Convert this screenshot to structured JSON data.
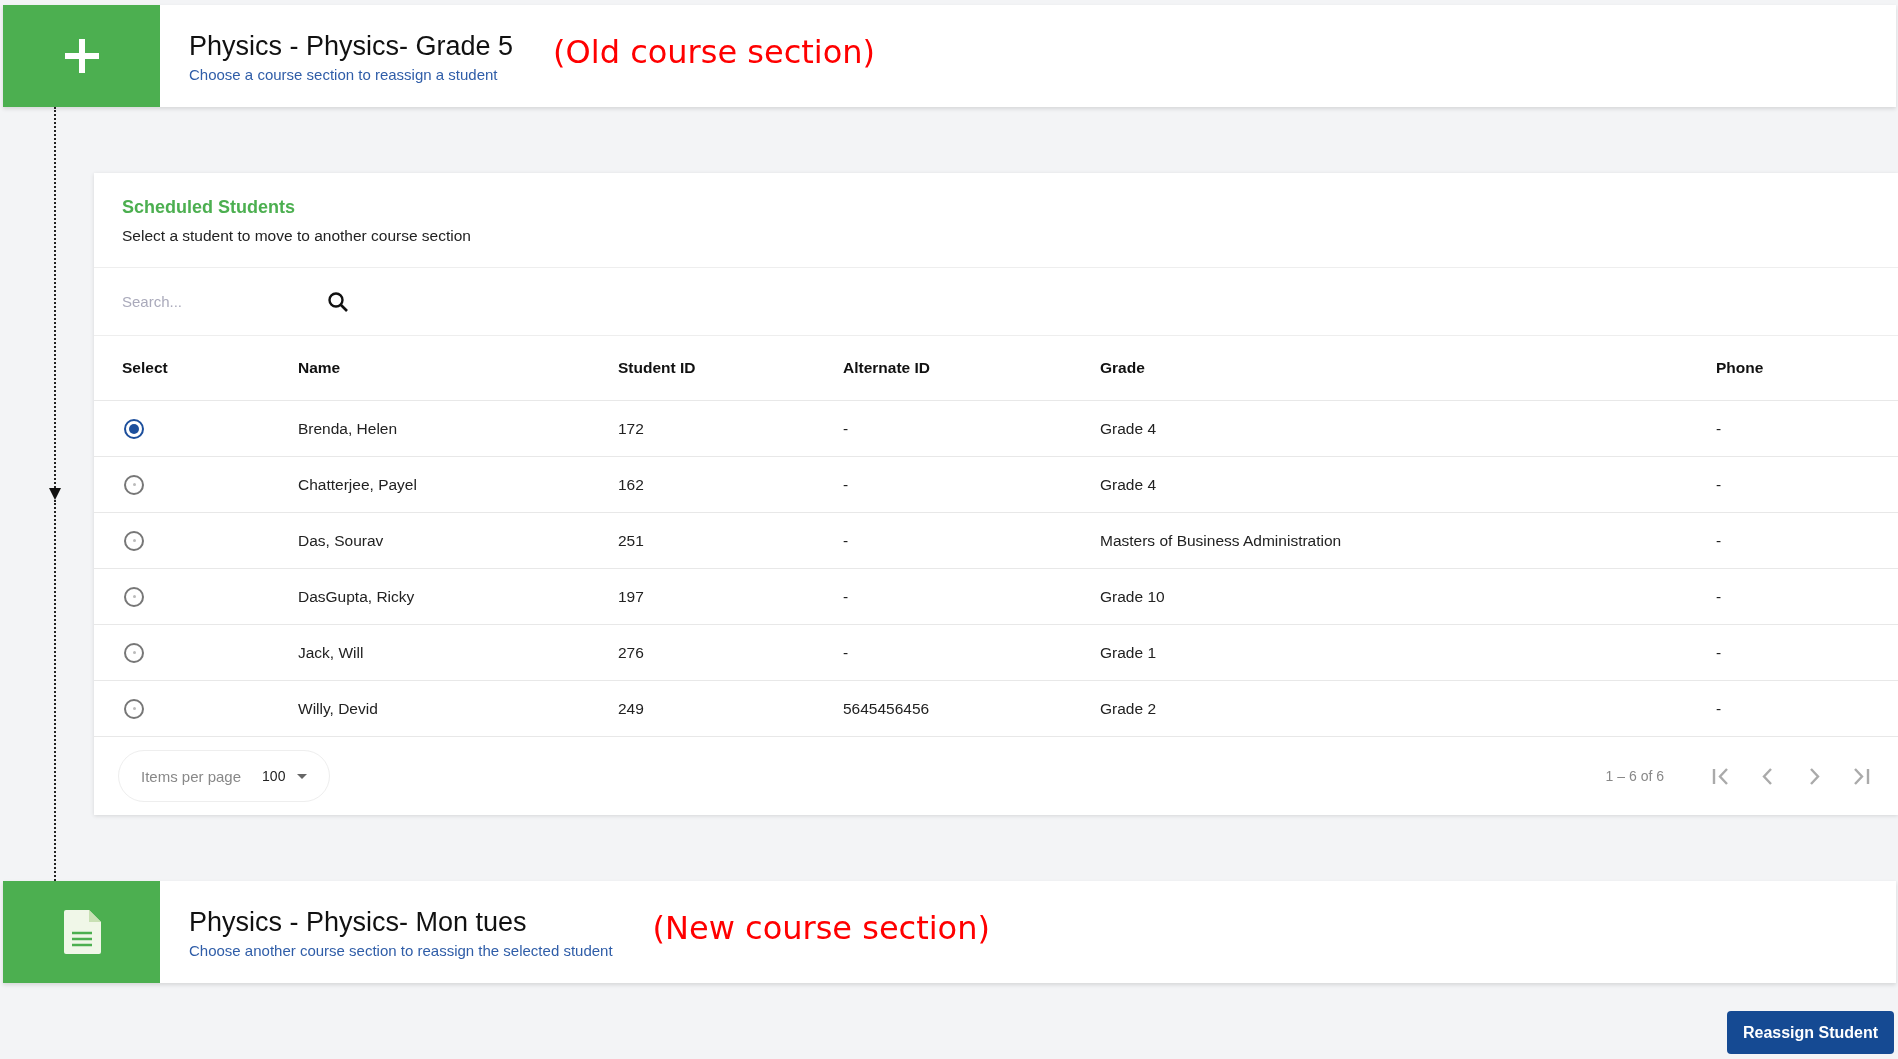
{
  "old_section": {
    "kind": "plus",
    "title": "Physics - Physics- Grade 5",
    "subtitle": "Choose a course section to reassign a student",
    "annotation": "(Old course section)"
  },
  "students_card": {
    "title": "Scheduled Students",
    "subtitle": "Select a student to move to another course section",
    "search": {
      "placeholder": "Search..."
    },
    "columns": [
      "Select",
      "Name",
      "Student ID",
      "Alternate ID",
      "Grade",
      "Phone"
    ],
    "rows": [
      {
        "selected": true,
        "name": "Brenda, Helen",
        "student_id": "172",
        "alternate_id": "-",
        "grade": "Grade 4",
        "phone": "-"
      },
      {
        "selected": false,
        "name": "Chatterjee, Payel",
        "student_id": "162",
        "alternate_id": "-",
        "grade": "Grade 4",
        "phone": "-"
      },
      {
        "selected": false,
        "name": "Das, Sourav",
        "student_id": "251",
        "alternate_id": "-",
        "grade": "Masters of Business Administration",
        "phone": "-"
      },
      {
        "selected": false,
        "name": "DasGupta, Ricky",
        "student_id": "197",
        "alternate_id": "-",
        "grade": "Grade 10",
        "phone": "-"
      },
      {
        "selected": false,
        "name": "Jack, Will",
        "student_id": "276",
        "alternate_id": "-",
        "grade": "Grade 1",
        "phone": "-"
      },
      {
        "selected": false,
        "name": "Willy, Devid",
        "student_id": "249",
        "alternate_id": "5645456456",
        "grade": "Grade 2",
        "phone": "-"
      }
    ],
    "paginator": {
      "items_per_page_label": "Items per page",
      "items_per_page": "100",
      "range": "1 – 6 of 6"
    }
  },
  "new_section": {
    "kind": "document",
    "title": "Physics - Physics- Mon tues",
    "subtitle": "Choose another course section to reassign the selected student",
    "annotation": "(New course section)"
  },
  "reassign_button": "Reassign Student"
}
